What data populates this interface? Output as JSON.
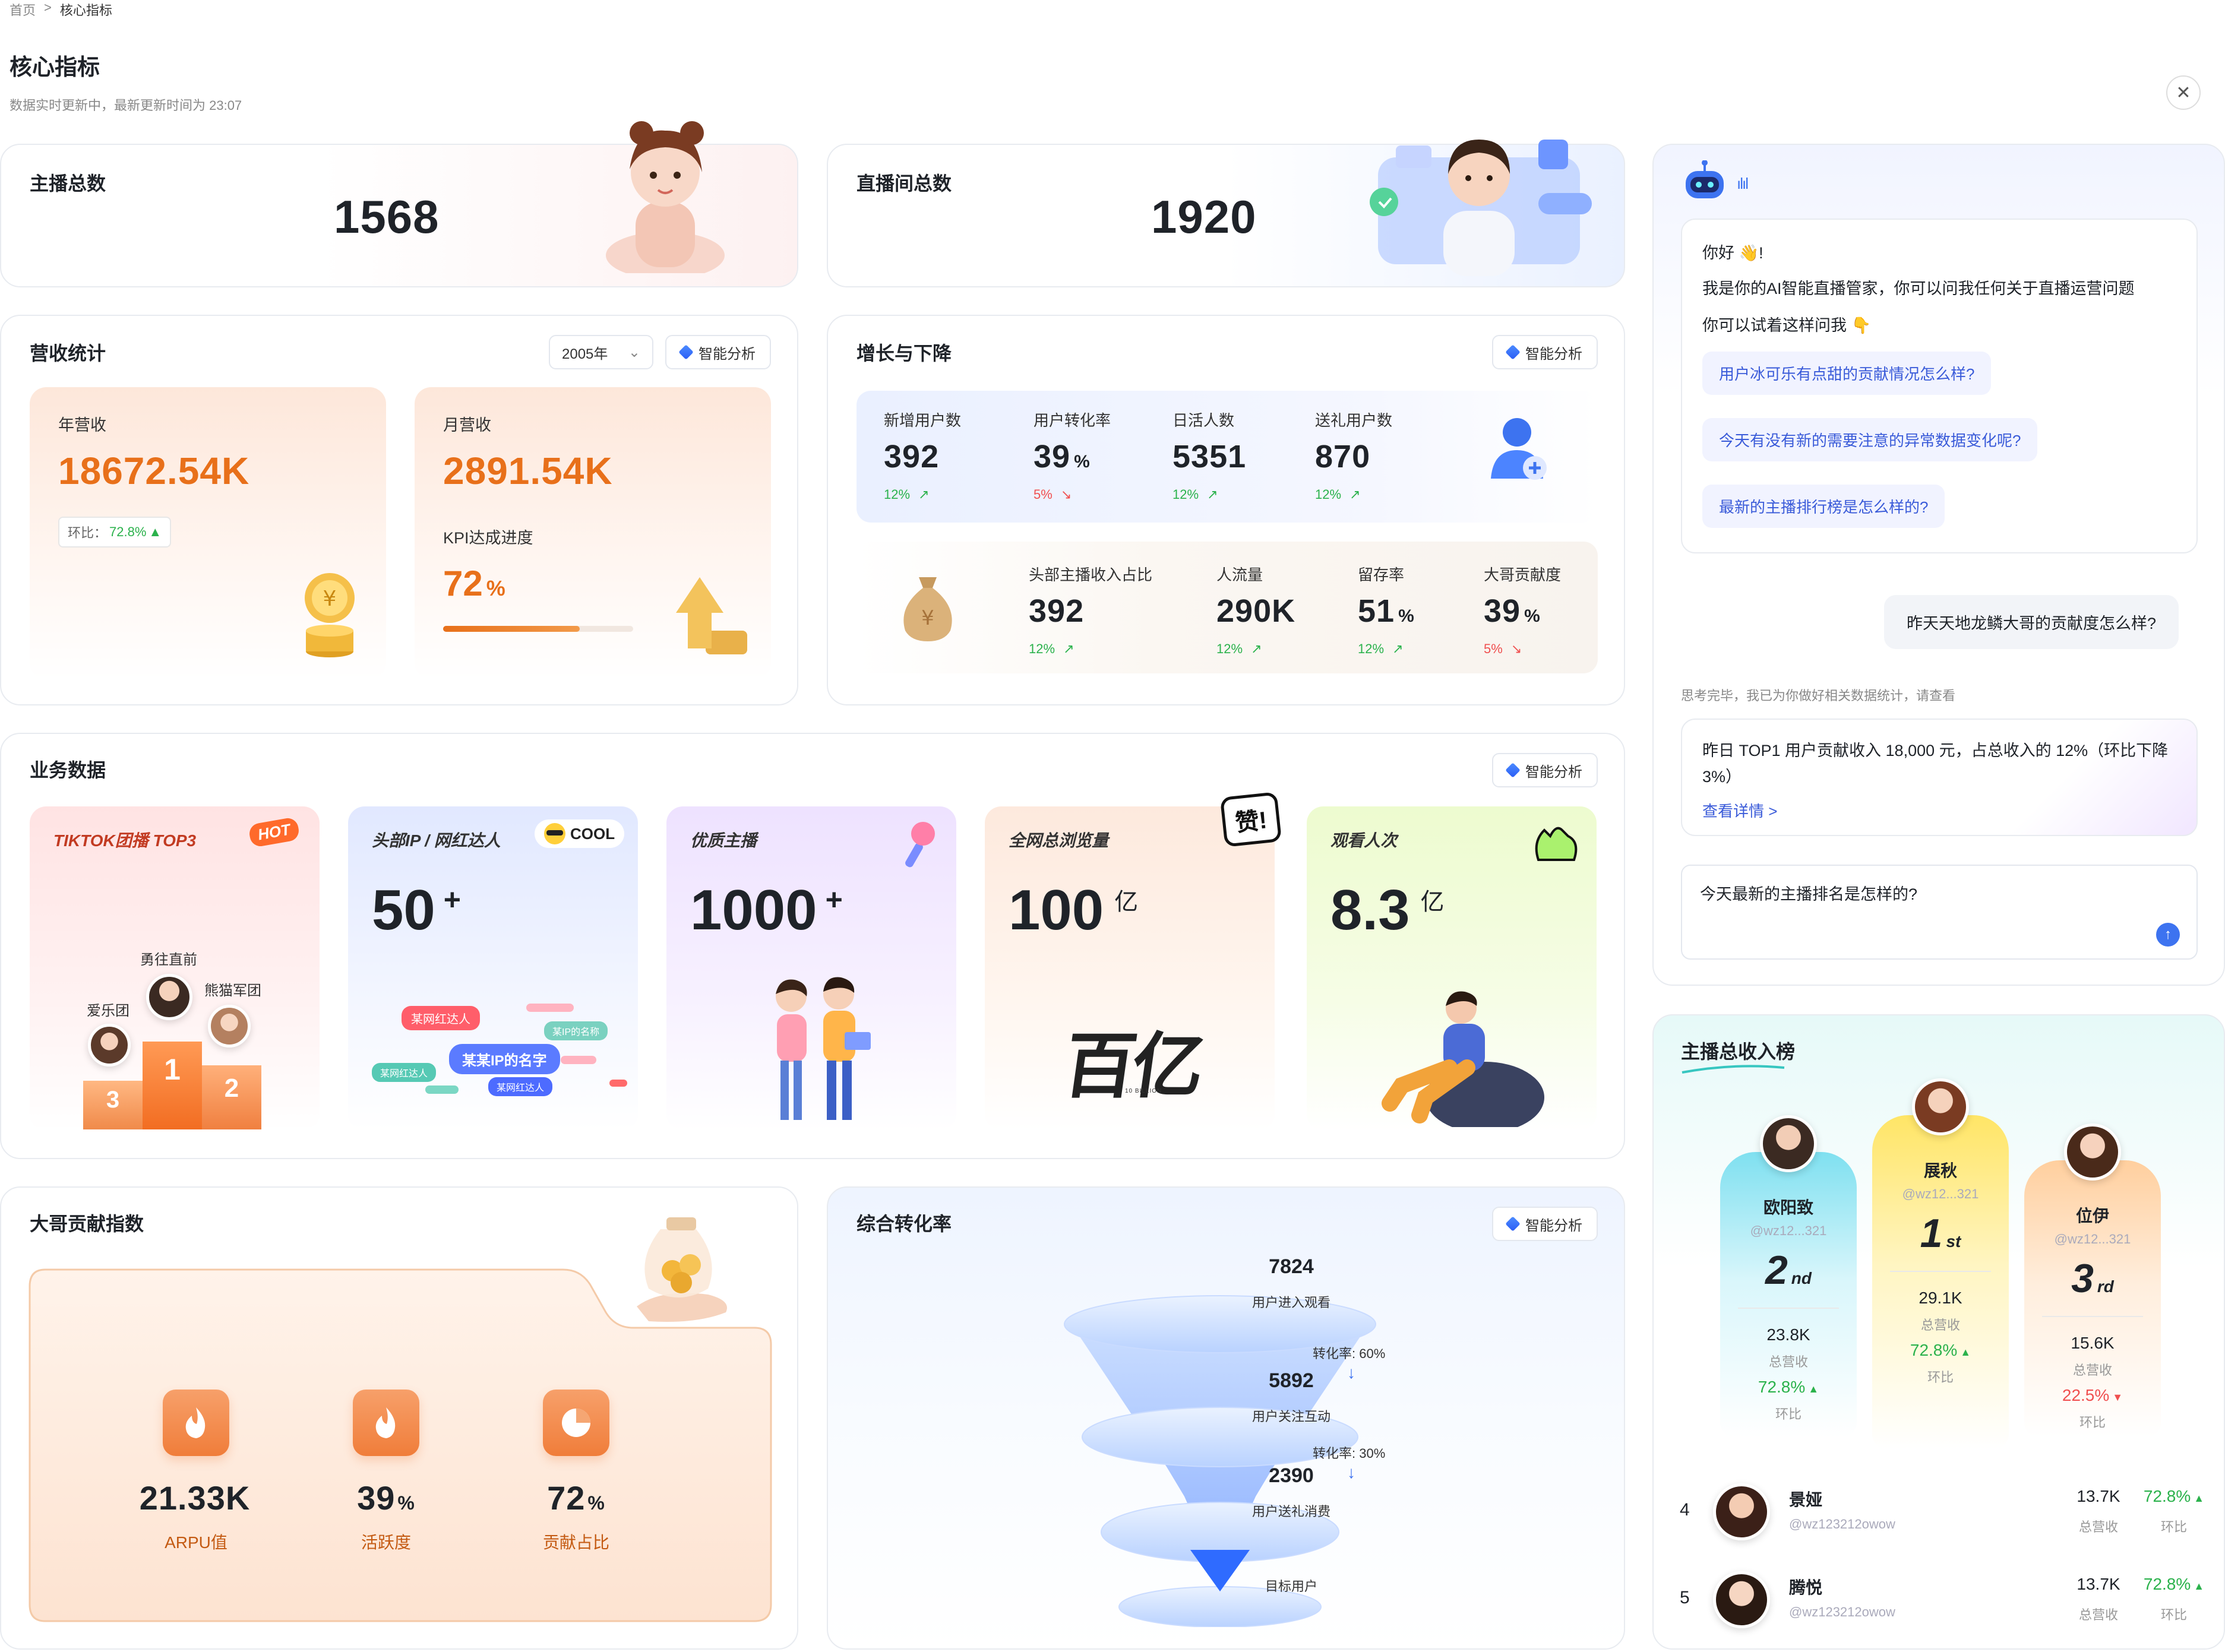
{
  "breadcrumb": {
    "home": "首页",
    "sep": ">",
    "current": "核心指标"
  },
  "page": {
    "title": "核心指标",
    "subtitle": "数据实时更新中，最新更新时间为 23:07"
  },
  "anchors_card": {
    "label": "主播总数",
    "value": "1568"
  },
  "rooms_card": {
    "label": "直播间总数",
    "value": "1920"
  },
  "revenue": {
    "title": "营收统计",
    "year": "2005年",
    "ai_btn": "智能分析",
    "annual": {
      "label": "年营收",
      "value": "18672.54K",
      "ratio_label": "环比：",
      "ratio": "72.8%"
    },
    "monthly": {
      "label": "月营收",
      "value": "2891.54K",
      "kpi_label": "KPI达成进度",
      "kpi_value": "72",
      "kpi_unit": "%",
      "kpi_progress": 0.72
    }
  },
  "growth": {
    "title": "增长与下降",
    "ai_btn": "智能分析",
    "row1": [
      {
        "label": "新增用户数",
        "value": "392",
        "unit": "",
        "change": "12%",
        "dir": "up"
      },
      {
        "label": "用户转化率",
        "value": "39",
        "unit": "%",
        "change": "5%",
        "dir": "down"
      },
      {
        "label": "日活人数",
        "value": "5351",
        "unit": "",
        "change": "12%",
        "dir": "up"
      },
      {
        "label": "送礼用户数",
        "value": "870",
        "unit": "",
        "change": "12%",
        "dir": "up"
      }
    ],
    "row2": [
      {
        "label": "头部主播收入占比",
        "value": "392",
        "unit": "",
        "change": "12%",
        "dir": "up"
      },
      {
        "label": "人流量",
        "value": "290K",
        "unit": "",
        "change": "12%",
        "dir": "up"
      },
      {
        "label": "留存率",
        "value": "51",
        "unit": "%",
        "change": "12%",
        "dir": "up"
      },
      {
        "label": "大哥贡献度",
        "value": "39",
        "unit": "%",
        "change": "5%",
        "dir": "down"
      }
    ]
  },
  "business": {
    "title": "业务数据",
    "ai_btn": "智能分析",
    "tiktok": {
      "title": "TIKTOK团播 TOP3",
      "hot": "HOT",
      "first": "勇往直前",
      "second": "熊猫军团",
      "third": "爱乐团",
      "n1": "1",
      "n2": "2",
      "n3": "3"
    },
    "ip": {
      "title": "头部IP / 网红达人",
      "badge": "COOL",
      "value": "50",
      "sup": "+",
      "tags": [
        "某网红达人",
        "某IP的名称",
        "某某IP的名字",
        "某网红达人",
        "某网红达人"
      ]
    },
    "quality": {
      "title": "优质主播",
      "value": "1000",
      "sup": "+"
    },
    "views": {
      "title": "全网总浏览量",
      "value": "100",
      "sup": "亿",
      "badge": "赞!",
      "art": "百亿",
      "art_sub": "10 BILLION"
    },
    "watch": {
      "title": "观看人次",
      "value": "8.3",
      "sup": "亿"
    }
  },
  "contribution": {
    "title": "大哥贡献指数",
    "items": [
      {
        "value": "21.33K",
        "unit": "",
        "label": "ARPU值"
      },
      {
        "value": "39",
        "unit": "%",
        "label": "活跃度"
      },
      {
        "value": "72",
        "unit": "%",
        "label": "贡献占比"
      }
    ]
  },
  "conversion": {
    "title": "综合转化率",
    "ai_btn": "智能分析",
    "stages": [
      {
        "value": "7824",
        "label": "用户进入观看"
      },
      {
        "value": "5892",
        "label": "用户关注互动"
      },
      {
        "value": "2390",
        "label": "用户送礼消费"
      },
      {
        "value": "",
        "label": "目标用户"
      }
    ],
    "rate1": "转化率: 60%",
    "rate2": "转化率: 30%"
  },
  "assistant": {
    "greet": "你好 👋!",
    "intro": "我是你的AI智能直播管家，你可以问我任何关于直播运营问题",
    "try": "你可以试着这样问我 👇",
    "suggestions": [
      "用户冰可乐有点甜的贡献情况怎么样?",
      "今天有没有新的需要注意的异常数据变化呢?",
      "最新的主播排行榜是怎么样的?"
    ],
    "user_msg": "昨天天地龙鳞大哥的贡献度怎么样?",
    "thinking": "思考完毕，我已为你做好相关数据统计，请查看",
    "answer": "昨日 TOP1 用户贡献收入 18,000 元，占总收入的 12%（环比下降 3%）",
    "detail_link": "查看详情 >",
    "input_value": "今天最新的主播排名是怎样的?"
  },
  "ranking": {
    "title": "主播总收入榜",
    "podium": [
      {
        "rank": "2",
        "suffix": "nd",
        "name": "欧阳致",
        "id": "@wz12...321",
        "revenue": "23.8K",
        "revenue_label": "总营收",
        "ratio": "72.8%",
        "dir": "up",
        "ratio_label": "环比"
      },
      {
        "rank": "1",
        "suffix": "st",
        "name": "展秋",
        "id": "@wz12...321",
        "revenue": "29.1K",
        "revenue_label": "总营收",
        "ratio": "72.8%",
        "dir": "up",
        "ratio_label": "环比"
      },
      {
        "rank": "3",
        "suffix": "rd",
        "name": "位伊",
        "id": "@wz12...321",
        "revenue": "15.6K",
        "revenue_label": "总营收",
        "ratio": "22.5%",
        "dir": "down",
        "ratio_label": "环比"
      }
    ],
    "list": [
      {
        "rank": "4",
        "name": "景娅",
        "id": "@wz123212owow",
        "revenue": "13.7K",
        "revenue_label": "总营收",
        "ratio": "72.8%",
        "ratio_label": "环比"
      },
      {
        "rank": "5",
        "name": "腾悦",
        "id": "@wz123212owow",
        "revenue": "13.7K",
        "revenue_label": "总营收",
        "ratio": "72.8%",
        "ratio_label": "环比"
      }
    ]
  },
  "colors": {
    "accent": "#e8701a",
    "up": "#2bb24c",
    "down": "#f05050",
    "link": "#3a5bd9"
  }
}
